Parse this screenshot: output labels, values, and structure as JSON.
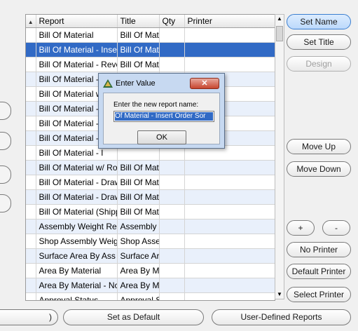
{
  "table": {
    "columns": [
      "Report",
      "Title",
      "Qty",
      "Printer"
    ],
    "sort_indicator": "▲",
    "rows": [
      {
        "report": "Bill Of Material",
        "title": "Bill Of Matе",
        "qty": "",
        "printer": ""
      },
      {
        "report": "Bill Of Material - Inser",
        "title": "Bill Of Mat",
        "qty": "",
        "printer": ""
      },
      {
        "report": "Bill Of Material - Reve",
        "title": "Bill Of Mat",
        "qty": "",
        "printer": ""
      },
      {
        "report": "Bill Of Material - I",
        "title": "",
        "qty": "",
        "printer": ""
      },
      {
        "report": "Bill Of Material w",
        "title": "",
        "qty": "",
        "printer": ""
      },
      {
        "report": "Bill Of Material - A",
        "title": "",
        "qty": "",
        "printer": ""
      },
      {
        "report": "Bill Of Material - A",
        "title": "",
        "qty": "",
        "printer": ""
      },
      {
        "report": "Bill Of Material - I",
        "title": "",
        "qty": "",
        "printer": ""
      },
      {
        "report": "Bill Of Material - I",
        "title": "",
        "qty": "",
        "printer": ""
      },
      {
        "report": "Bill Of Material w/ Ro",
        "title": "Bill Of Mat",
        "qty": "",
        "printer": ""
      },
      {
        "report": "Bill Of Material - Draw",
        "title": "Bill Of Mat",
        "qty": "",
        "printer": ""
      },
      {
        "report": "Bill Of Material - Draw",
        "title": "Bill Of Mat",
        "qty": "",
        "printer": ""
      },
      {
        "report": "Bill Of Material (Shipp",
        "title": "Bill Of Mat",
        "qty": "",
        "printer": ""
      },
      {
        "report": "Assembly Weight Re",
        "title": "Assembly",
        "qty": "",
        "printer": ""
      },
      {
        "report": "Shop Assembly Weig",
        "title": "Shop Asse",
        "qty": "",
        "printer": ""
      },
      {
        "report": "Surface Area By Ass",
        "title": "Surface Ar",
        "qty": "",
        "printer": ""
      },
      {
        "report": "Area By Material",
        "title": "Area By M",
        "qty": "",
        "printer": ""
      },
      {
        "report": "Area By Material - Nc",
        "title": "Area By M",
        "qty": "",
        "printer": ""
      },
      {
        "report": "Approval Status",
        "title": "Approval S",
        "qty": "",
        "printer": ""
      }
    ],
    "selected_row_index": 1
  },
  "scrollbar": {
    "up": "▲",
    "down": "▼"
  },
  "side_buttons": {
    "set_name": "Set Name",
    "set_title": "Set Title",
    "design": "Design",
    "move_up": "Move Up",
    "move_down": "Move Down",
    "plus": "+",
    "minus": "-",
    "no_printer": "No Printer",
    "default_printer": "Default Printer",
    "select_printer": "Select Printer"
  },
  "bottom_buttons": {
    "left_partial": ")",
    "set_as_default": "Set as Default",
    "user_defined_reports": "User-Defined Reports"
  },
  "dialog": {
    "title": "Enter Value",
    "close": "✕",
    "prompt": "Enter the new report name:",
    "input_value": "Of Material - Insert Order Sor",
    "ok": "OK"
  },
  "colors": {
    "selection": "#316ac5",
    "accent_button": "#bcd9fb",
    "dialog_frame": "#c7d9f1",
    "close_button": "#c7452f"
  }
}
